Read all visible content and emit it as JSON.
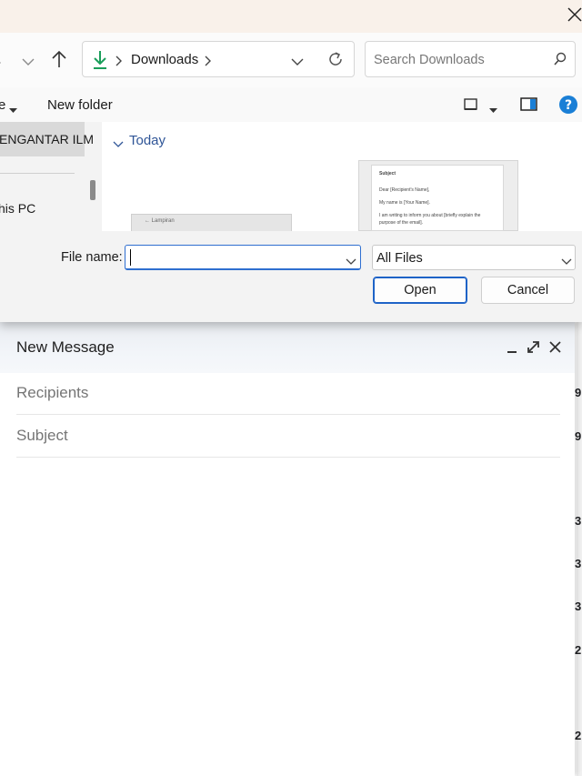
{
  "dialog": {
    "address": {
      "folder": "Downloads"
    },
    "search": {
      "placeholder": "Search Downloads"
    },
    "toolbar": {
      "left_fragment": "e",
      "new_folder": "New folder"
    },
    "nav_pane": {
      "items": [
        {
          "label": "ENGANTAR ILM",
          "selected": true
        },
        {
          "label": "his PC",
          "selected": false
        }
      ]
    },
    "content": {
      "group_label": "Today",
      "thumbnail_1": {
        "text": "← Lampiran"
      },
      "thumbnail_2": {
        "lines": [
          "Subject",
          "Dear [Recipient's Name],",
          "My name is [Your Name].",
          "I am writing to inform you about [briefly explain the",
          "purpose of the email]."
        ]
      }
    },
    "file_name": {
      "label": "File name:",
      "value": ""
    },
    "file_type": {
      "selected": "All Files"
    },
    "buttons": {
      "open": "Open",
      "cancel": "Cancel"
    }
  },
  "compose": {
    "title": "New Message",
    "recipients_placeholder": "Recipients",
    "subject_placeholder": "Subject"
  },
  "background": {
    "edge_digits": [
      "9",
      "9",
      "3",
      "3",
      "3",
      "2",
      "2"
    ]
  },
  "colors": {
    "accent_blue": "#1e63c7",
    "download_green": "#1a9e5a",
    "help_blue": "#1a7fd6",
    "today_blue": "#2f5597"
  }
}
